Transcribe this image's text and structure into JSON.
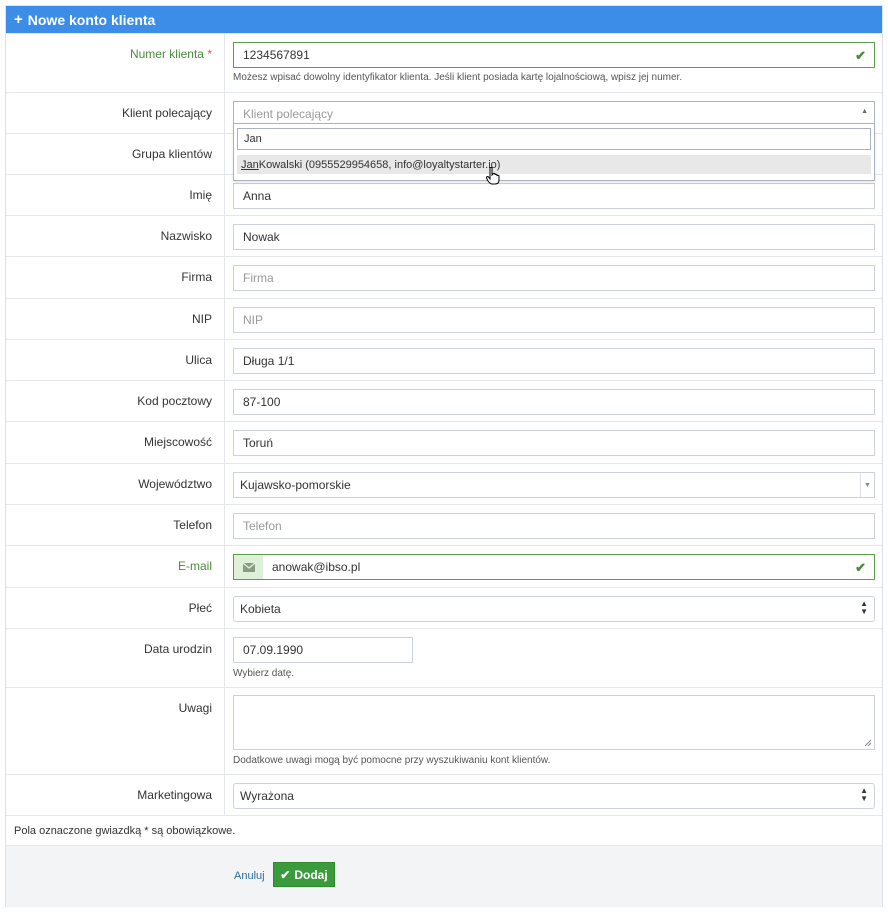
{
  "header": {
    "title": "Nowe konto klienta"
  },
  "customer_number": {
    "label": "Numer klienta",
    "value": "1234567891",
    "help": "Możesz wpisać dowolny identyfikator klienta. Jeśli klient posiada kartę lojalnościową, wpisz jej numer."
  },
  "referrer": {
    "label": "Klient polecający",
    "placeholder": "Klient polecający",
    "search_value": "Jan",
    "option_match": "Jan",
    "option_rest": " Kowalski (0955529954658, info@loyaltystarter.io)"
  },
  "customer_group": {
    "label": "Grupa klientów"
  },
  "first_name": {
    "label": "Imię",
    "value": "Anna"
  },
  "last_name": {
    "label": "Nazwisko",
    "value": "Nowak"
  },
  "company": {
    "label": "Firma",
    "placeholder": "Firma"
  },
  "nip": {
    "label": "NIP",
    "placeholder": "NIP"
  },
  "street": {
    "label": "Ulica",
    "value": "Długa 1/1"
  },
  "postal_code": {
    "label": "Kod pocztowy",
    "value": "87-100"
  },
  "city": {
    "label": "Miejscowość",
    "value": "Toruń"
  },
  "voivodeship": {
    "label": "Województwo",
    "value": "Kujawsko-pomorskie"
  },
  "phone": {
    "label": "Telefon",
    "placeholder": "Telefon"
  },
  "email": {
    "label": "E-mail",
    "value": "anowak@ibso.pl"
  },
  "gender": {
    "label": "Płeć",
    "value": "Kobieta"
  },
  "birth_date": {
    "label": "Data urodzin",
    "value": "07.09.1990",
    "help": "Wybierz datę."
  },
  "notes": {
    "label": "Uwagi",
    "value": "",
    "help": "Dodatkowe uwagi mogą być pomocne przy wyszukiwaniu kont klientów."
  },
  "marketing": {
    "label": "Marketingowa",
    "value": "Wyrażona"
  },
  "required_note": "Pola oznaczone gwiazdką * są obowiązkowe.",
  "actions": {
    "cancel_label": "Anuluj",
    "submit_label": "Dodaj"
  },
  "colors": {
    "header_bg": "#3c8de8",
    "valid": "#4a8b3c",
    "submit_bg": "#3a9b3c"
  }
}
